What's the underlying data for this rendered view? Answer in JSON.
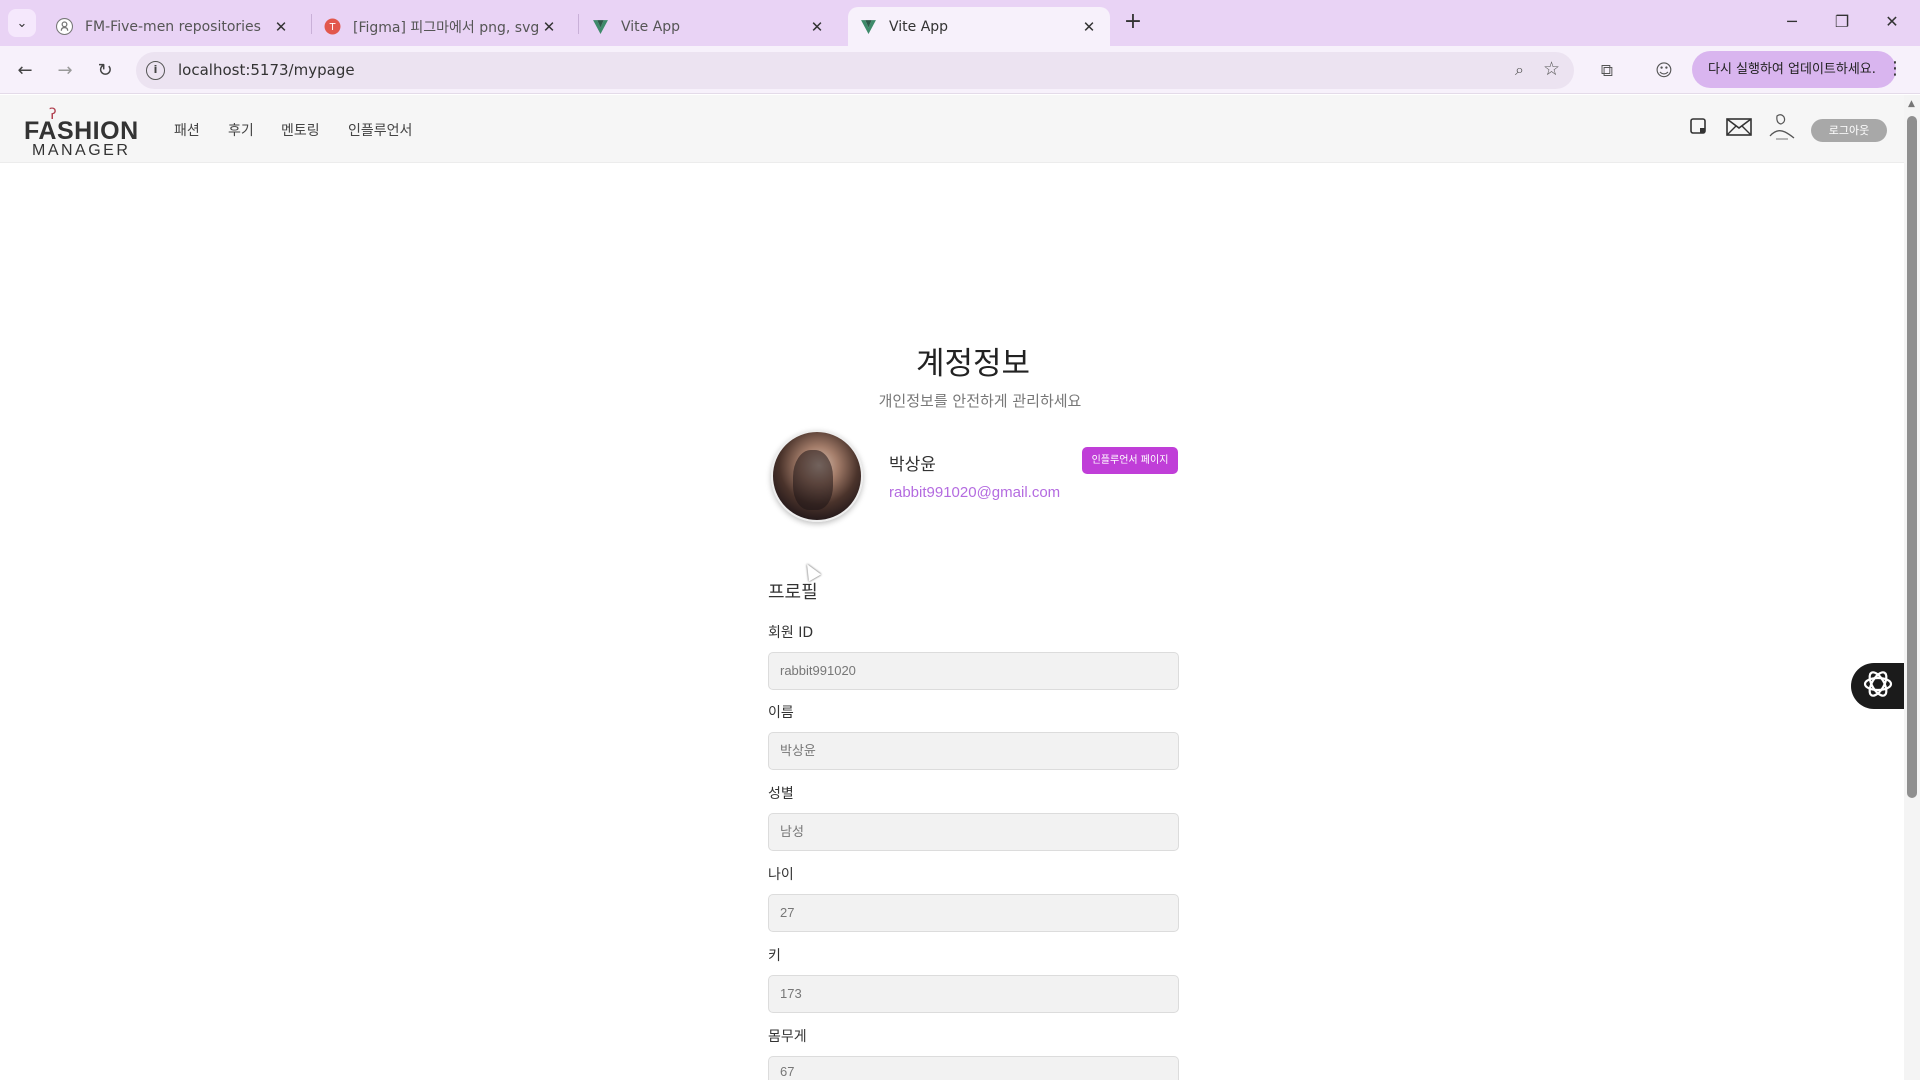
{
  "browser": {
    "tabs": [
      {
        "title": "FM-Five-men repositories",
        "icon": "github-icon"
      },
      {
        "title": "[Figma] 피그마에서 png, svg, ...",
        "icon": "figma-icon"
      },
      {
        "title": "Vite App",
        "icon": "vite-icon"
      },
      {
        "title": "Vite App",
        "icon": "vite-icon",
        "active": true
      }
    ],
    "url": "localhost:5173/mypage",
    "update_label": "다시 실행하여 업데이트하세요.",
    "accent_color": "#e9d3f5"
  },
  "header": {
    "logo_top": "FASHION",
    "logo_bottom": "MANAGER",
    "nav": [
      "패션",
      "후기",
      "멘토링",
      "인플루언서"
    ],
    "logout_label": "로그아웃",
    "icons": [
      "tablet-icon",
      "mail-icon",
      "profile-sketch-icon"
    ]
  },
  "main": {
    "title": "계정정보",
    "subtitle": "개인정보를 안전하게 관리하세요",
    "user": {
      "name": "박상윤",
      "email": "rabbit991020@gmail.com",
      "influencer_button": "인플루언서 페이지"
    },
    "section_title": "프로필",
    "fields": [
      {
        "label": "회원 ID",
        "value": "rabbit991020"
      },
      {
        "label": "이름",
        "value": "박상윤"
      },
      {
        "label": "성별",
        "value": "남성"
      },
      {
        "label": "나이",
        "value": "27"
      },
      {
        "label": "키",
        "value": "173"
      },
      {
        "label": "몸무게",
        "value": "67"
      }
    ],
    "accent_color": "#c03ed8",
    "email_color": "#b46be0"
  }
}
